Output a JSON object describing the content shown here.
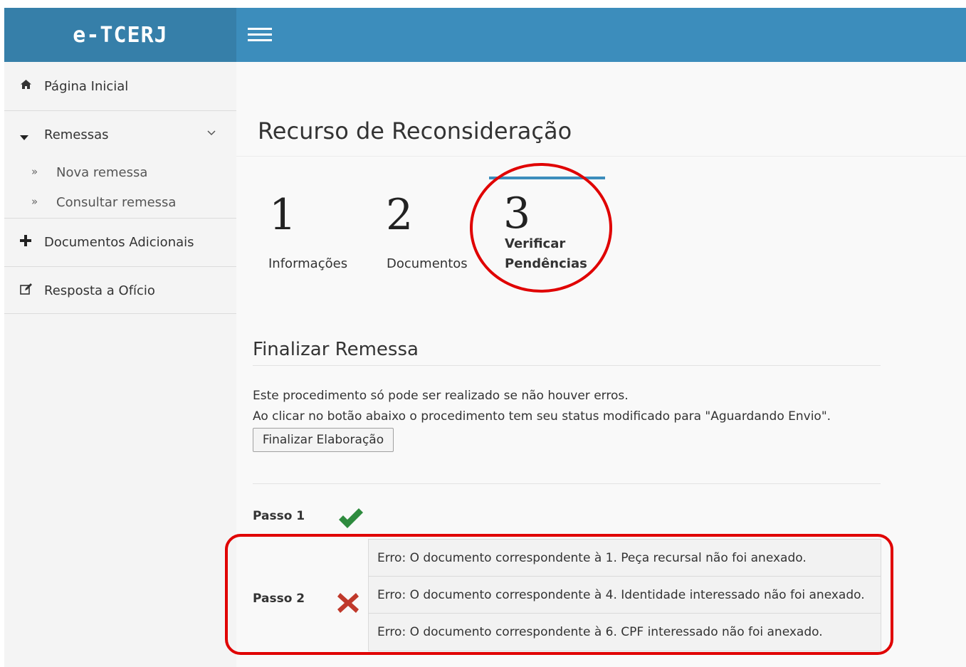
{
  "app": {
    "brand": "e-TCERJ"
  },
  "sidebar": {
    "items": [
      {
        "label": "Página Inicial",
        "icon": "home-icon"
      },
      {
        "label": "Remessas",
        "icon": "caret-down-icon"
      },
      {
        "label": "Documentos Adicionais",
        "icon": "plus-icon"
      },
      {
        "label": "Resposta a Ofício",
        "icon": "edit-icon"
      }
    ],
    "subitems": [
      {
        "label": "Nova remessa",
        "icon": "double-chevron-right-icon"
      },
      {
        "label": "Consultar remessa",
        "icon": "double-chevron-right-icon"
      }
    ]
  },
  "page": {
    "title": "Recurso de Reconsideração"
  },
  "wizard": {
    "active_step": 3,
    "steps": [
      {
        "number": "1",
        "label": "Informações"
      },
      {
        "number": "2",
        "label": "Documentos"
      },
      {
        "number": "3",
        "label_line1": "Verificar",
        "label_line2": "Pendências"
      }
    ]
  },
  "finalize": {
    "title": "Finalizar Remessa",
    "line1": "Este procedimento só pode ser realizado se não houver erros.",
    "line2": "Ao clicar no botão abaixo o procedimento tem seu status modificado para \"Aguardando Envio\".",
    "button": "Finalizar Elaboração"
  },
  "checks": {
    "passo1": {
      "label": "Passo 1",
      "status": "ok"
    },
    "passo2": {
      "label": "Passo 2",
      "status": "error"
    },
    "errors": [
      "Erro: O documento correspondente à 1. Peça recursal não foi anexado.",
      "Erro: O documento correspondente à 4. Identidade interessado não foi anexado.",
      "Erro: O documento correspondente à 6. CPF interessado não foi anexado."
    ]
  },
  "colors": {
    "header": "#3c8dbc",
    "brand_bg": "#367fa9",
    "ok": "#2e8b3e",
    "error": "#c0392b",
    "annotation": "#e00000"
  }
}
